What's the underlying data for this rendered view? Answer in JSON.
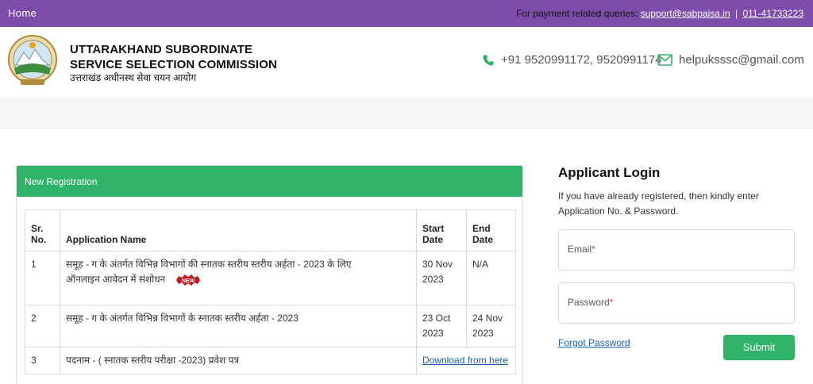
{
  "topbar": {
    "home": "Home",
    "queries_label": "For payment related queries:",
    "support_email": "support@sabpaisa.in",
    "separator": "|",
    "support_phone": "011-41733223",
    "bg_color": "#7e4dac"
  },
  "header": {
    "org_line1": "UTTARAKHAND SUBORDINATE",
    "org_line2": "SERVICE SELECTION COMMISSION",
    "org_hindi": "उत्तराखंड अधीनस्थ सेवा चयन आयोग",
    "phone_icon": "phone-icon",
    "phone": "+91 9520991172, 9520991174",
    "mail_icon": "envelope-icon",
    "email": "helpuksssc@gmail.com"
  },
  "registration": {
    "title": "New Registration",
    "header_color": "#2fb36a",
    "columns": {
      "sr_line1": "Sr.",
      "sr_line2": "No.",
      "name": "Application Name",
      "start_line1": "Start",
      "start_line2": "Date",
      "end": "End Date"
    },
    "rows": [
      {
        "sr": "1",
        "name_line1": "समूह - ग के अंतर्गत विभिन्न विभागों की स्नातक स्तरीय स्तरीय अर्हता - 2023 के लिए",
        "name_line2": "ऑनलाइन आवेदन में संशोधन",
        "badge": "NEW",
        "start_line1": "30 Nov",
        "start_line2": "2023",
        "end": "N/A"
      },
      {
        "sr": "2",
        "name": "समूह - ग के अंतर्गत विभिन्न विभागों के स्नातक स्तरीय अर्हता - 2023",
        "start_line1": "23 Oct",
        "start_line2": "2023",
        "end_line1": "24 Nov",
        "end_line2": "2023"
      },
      {
        "sr": "3",
        "name": "पदनाम - ( स्नातक स्तरीय परीक्षा -2023) प्रवेश पत्र",
        "link": "Download from here"
      }
    ]
  },
  "login": {
    "title": "Applicant Login",
    "description": "If you have already registered, then kindly enter Application No. & Password.",
    "email_label": "Email",
    "password_label": "Password",
    "required_mark": "*",
    "forgot": "Forgot Password",
    "submit": "Submit",
    "button_color": "#2fb36a"
  }
}
